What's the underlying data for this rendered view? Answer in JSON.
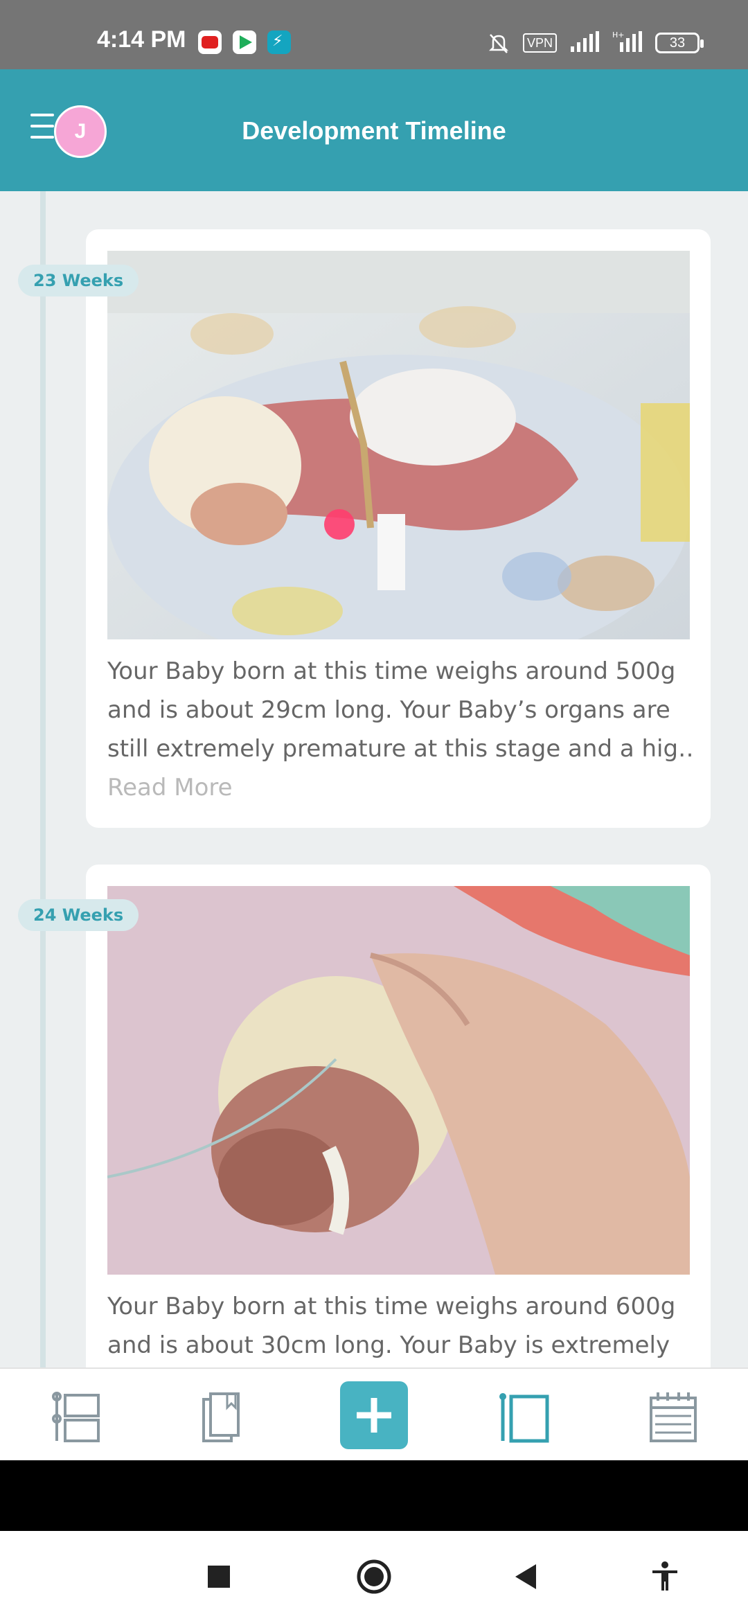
{
  "status_bar": {
    "time": "4:14 PM",
    "vpn": "VPN",
    "battery": "33",
    "icons": [
      "youtube-icon",
      "play-store-icon",
      "app-icon",
      "mute-icon",
      "signal-icon",
      "battery-icon"
    ]
  },
  "header": {
    "title": "Development Timeline",
    "avatar_initial": "J",
    "icons": [
      "menu-icon"
    ]
  },
  "timeline": {
    "entries": [
      {
        "week": "23 Weeks",
        "lines": [
          "Your Baby born at this time weighs around 500g",
          "and is about 29cm long. Your Baby’s organs are",
          "still extremely premature at this stage and a hig…"
        ],
        "read_more": "Read More"
      },
      {
        "week": "24 Weeks",
        "lines": [
          "Your Baby born at this time weighs around 600g",
          "and is about 30cm long. Your Baby is extremely"
        ]
      }
    ]
  },
  "bottom_nav": {
    "items": [
      "timeline-icon",
      "journal-icon",
      "add-icon",
      "notes-icon",
      "calendar-icon"
    ],
    "accent": "#48b3c2"
  },
  "system_nav": {
    "items": [
      "recent-apps-icon",
      "home-icon",
      "back-icon",
      "accessibility-icon"
    ]
  },
  "colors": {
    "primary": "#35a0b0",
    "status_bar": "#757575",
    "avatar": "#f6a6d6"
  }
}
